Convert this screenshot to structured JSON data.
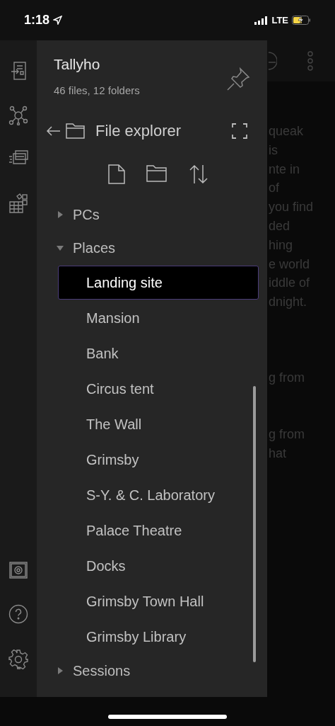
{
  "status_bar": {
    "time": "1:18",
    "network": "LTE"
  },
  "vault": {
    "name": "Tallyho",
    "stats": "46 files, 12 folders"
  },
  "explorer": {
    "title": "File explorer"
  },
  "tree": [
    {
      "label": "PCs",
      "expanded": false
    },
    {
      "label": "Places",
      "expanded": true,
      "children": [
        {
          "label": "Landing site",
          "selected": true
        },
        {
          "label": "Mansion",
          "selected": false
        },
        {
          "label": "Bank",
          "selected": false
        },
        {
          "label": "Circus tent",
          "selected": false
        },
        {
          "label": "The Wall",
          "selected": false
        },
        {
          "label": "Grimsby",
          "selected": false
        },
        {
          "label": "S-Y. & C. Laboratory",
          "selected": false
        },
        {
          "label": "Palace Theatre",
          "selected": false
        },
        {
          "label": "Docks",
          "selected": false
        },
        {
          "label": "Grimsby Town Hall",
          "selected": false
        },
        {
          "label": "Grimsby Library",
          "selected": false
        }
      ]
    },
    {
      "label": "Sessions",
      "expanded": false
    }
  ],
  "note_paragraphs": [
    [
      "queak",
      "is",
      "nte in",
      "of",
      "you find",
      "ded",
      "hing",
      "e world",
      "iddle of",
      "dnight."
    ],
    [
      "g from"
    ],
    [
      "g from",
      "hat"
    ]
  ]
}
